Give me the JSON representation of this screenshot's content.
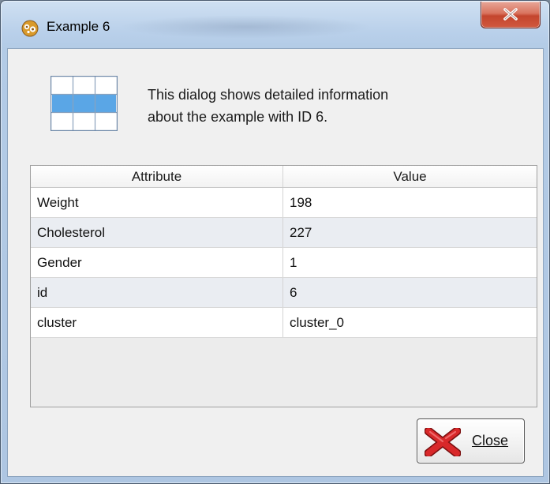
{
  "window": {
    "title": "Example 6",
    "app_icon": "rapidminer-gear-icon",
    "titlebar_close_icon": "close-icon"
  },
  "info": {
    "icon": "data-grid-icon",
    "line1": "This dialog shows detailed information",
    "line2": "about the example with ID 6."
  },
  "table": {
    "columns": [
      "Attribute",
      "Value"
    ],
    "rows": [
      {
        "attribute": "Weight",
        "value": "198"
      },
      {
        "attribute": "Cholesterol",
        "value": "227"
      },
      {
        "attribute": "Gender",
        "value": "1"
      },
      {
        "attribute": "id",
        "value": "6"
      },
      {
        "attribute": "cluster",
        "value": "cluster_0"
      }
    ]
  },
  "buttons": {
    "close_label": "Close",
    "close_icon": "red-x-icon"
  },
  "colors": {
    "titlebar_close": "#c4452d",
    "row_alt": "#eaedf2",
    "grid_icon_highlight": "#5aa6e6"
  }
}
